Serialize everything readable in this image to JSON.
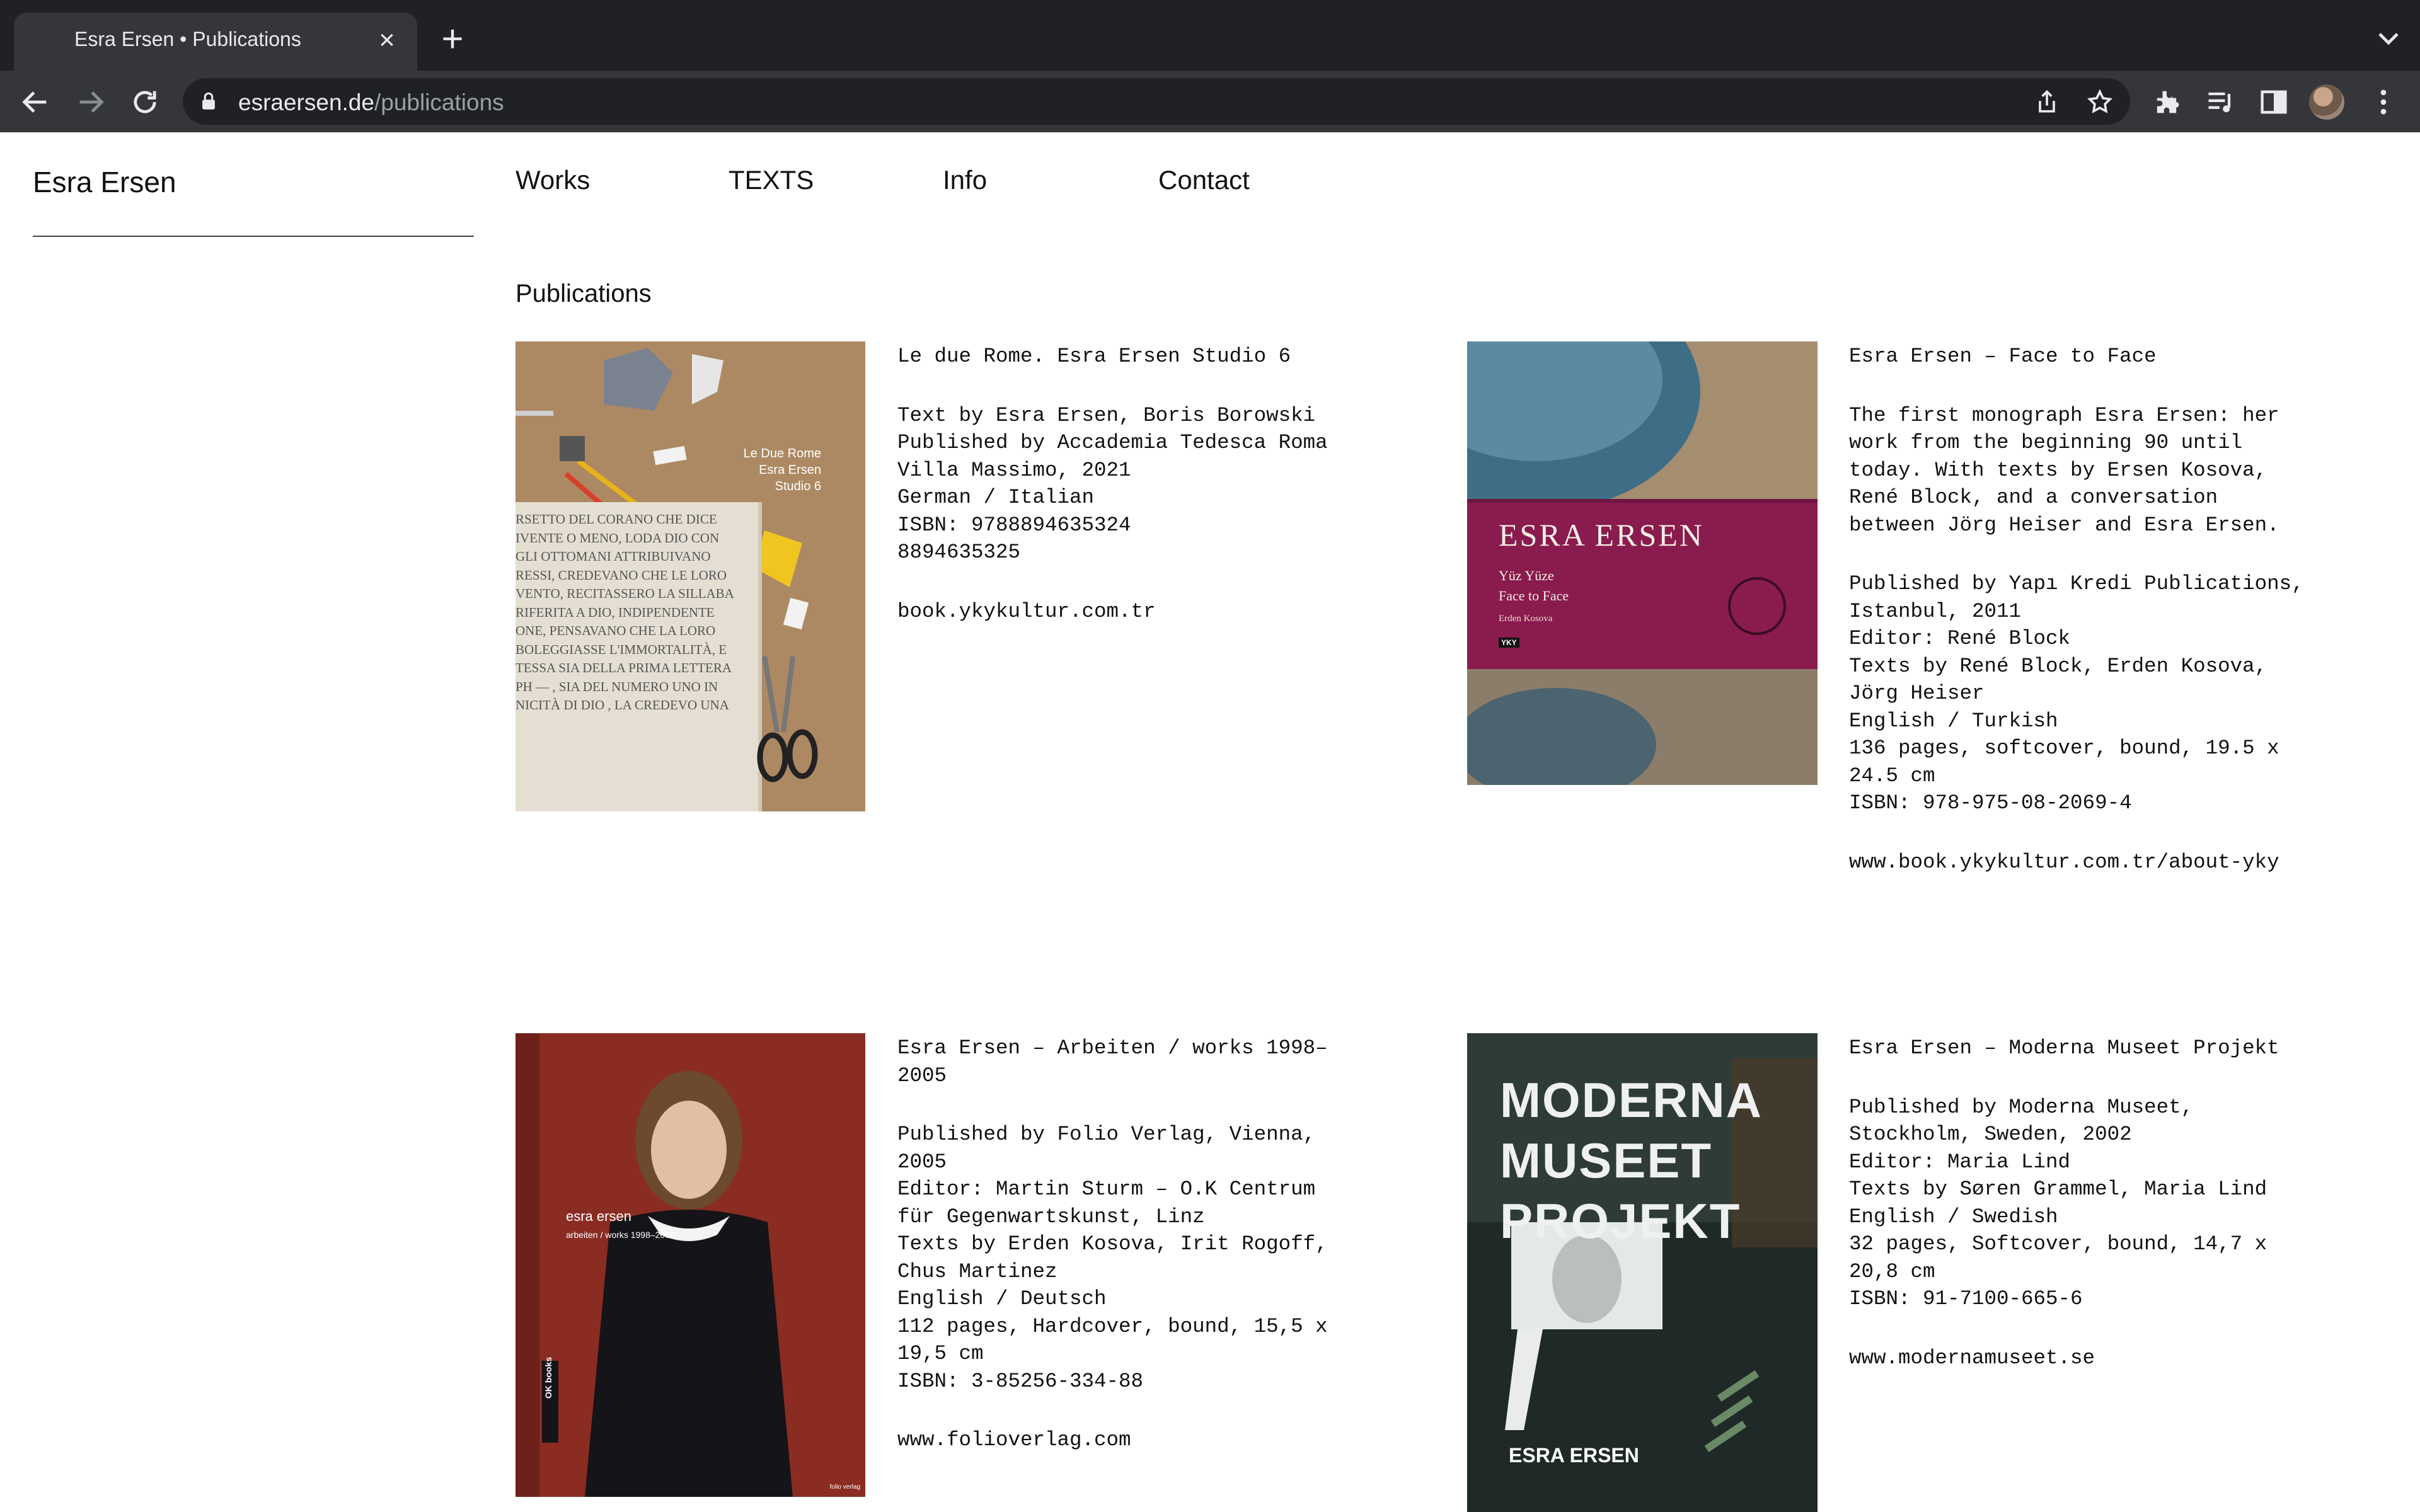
{
  "browser": {
    "tab_title": "Esra Ersen • Publications",
    "url_host": "esraersen.de",
    "url_path": "/publications"
  },
  "site": {
    "title": "Esra Ersen",
    "nav": [
      "Works",
      "TEXTS",
      "Info",
      "Contact"
    ],
    "section_title": "Publications"
  },
  "publications": [
    {
      "title": "Le due Rome. Esra Ersen Studio 6",
      "details": [
        "Text by Esra Ersen, Boris Borowski",
        "Published by Accademia Tedesca Roma",
        "Villa Massimo, 2021",
        "German / Italian",
        "ISBN: 9788894635324",
        "8894635325"
      ],
      "link": "book.ykykultur.com.tr",
      "cover_text": [
        "Le Due Rome",
        "Esra Ersen",
        "Studio 6"
      ],
      "cover_plaque": [
        "RSETTO DEL CORANO CHE DICE",
        "IVENTE O MENO, LODA DIO CON",
        "GLI OTTOMANI ATTRIBUIVANO",
        "RESSI, CREDEVANO CHE LE LORO",
        "VENTO, RECITASSERO LA SILLABA",
        "RIFERITA A DIO, INDIPENDENTE",
        "ONE, PENSAVANO CHE LA LORO",
        "BOLEGGIASSE L'IMMORTALITÀ, E",
        "TESSA SIA DELLA PRIMA LETTERA",
        "PH — , SIA DEL NUMERO UNO IN",
        "NICITÀ DI DIO , LA CREDEVO UNA"
      ]
    },
    {
      "title": "Esra Ersen – Face to Face",
      "intro": [
        "The first monograph Esra Ersen: her",
        "work from the beginning 90 until",
        "today. With texts by Ersen Kosova,",
        "René Block, and a conversation",
        "between Jörg Heiser and Esra Ersen."
      ],
      "details": [
        "Published by Yapı Kredi Publications,",
        "Istanbul, 2011",
        "Editor: René Block",
        "Texts by René Block, Erden Kosova,",
        "Jörg Heiser",
        "English / Turkish",
        "136 pages, softcover, bound, 19.5 x",
        "24.5 cm",
        "ISBN: 978-975-08-2069-4"
      ],
      "link": "www.book.ykykultur.com.tr/about-yky",
      "cover_text": [
        "ESRA ERSEN",
        "Yüz Yüze",
        "Face to Face",
        "Erden Kosova",
        "YKY"
      ]
    },
    {
      "title": "Esra Ersen – Arbeiten / works 1998–\n2005",
      "details": [
        "Published by Folio Verlag, Vienna,",
        "2005",
        "Editor: Martin Sturm – O.K Centrum",
        "für Gegenwartskunst, Linz",
        "Texts by Erden Kosova, Irit Rogoff,",
        "Chus Martinez",
        "English / Deutsch",
        "112 pages, Hardcover, bound, 15,5 x",
        "19,5 cm",
        "ISBN: 3-85256-334-88"
      ],
      "link": "www.folioverlag.com",
      "cover_text": [
        "esra ersen",
        "arbeiten / works 1998–2005",
        "OK books",
        "folio verlag"
      ]
    },
    {
      "title": "Esra Ersen – Moderna Museet Projekt",
      "details": [
        "Published by Moderna Museet,",
        "Stockholm, Sweden, 2002",
        "Editor: Maria Lind",
        "Texts by Søren Grammel, Maria Lind",
        "English / Swedish",
        "32 pages, Softcover, bound, 14,7 x",
        "20,8 cm",
        "ISBN: 91-7100-665-6"
      ],
      "link": "www.modernamuseet.se",
      "cover_text": [
        "MODERNA",
        "MUSEET",
        "PROJEKT",
        "ESRA ERSEN"
      ]
    }
  ]
}
